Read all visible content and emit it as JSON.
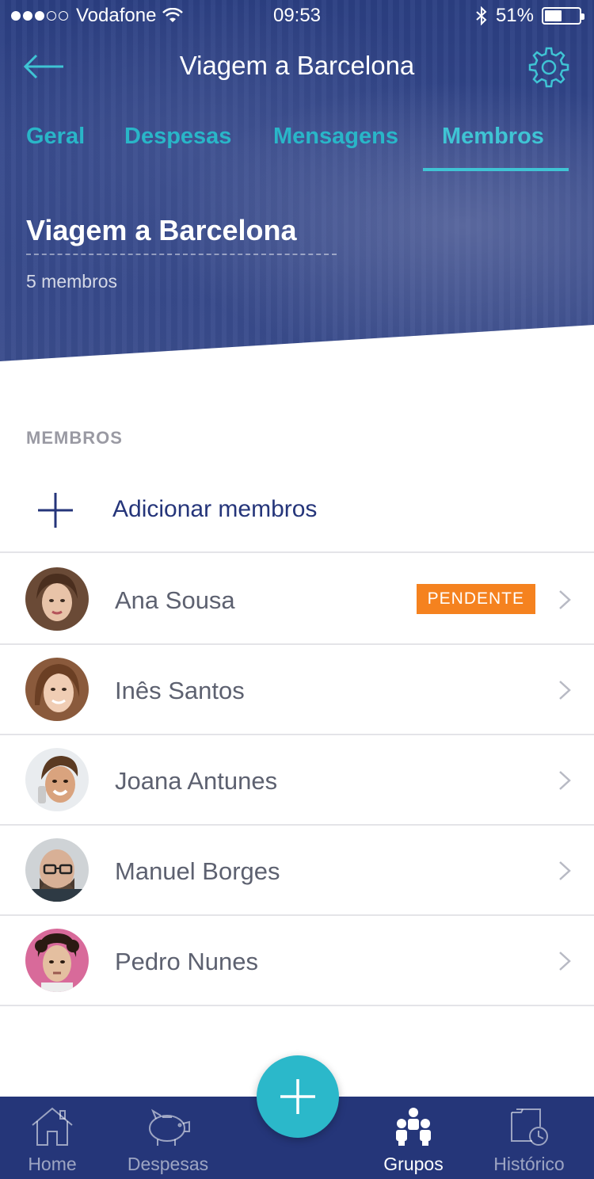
{
  "status_bar": {
    "carrier": "Vodafone",
    "time": "09:53",
    "battery": "51%",
    "battery_level": 0.51
  },
  "nav": {
    "title": "Viagem a Barcelona",
    "back_icon": "arrow-left-icon",
    "settings_icon": "gear-icon"
  },
  "tabs": [
    {
      "label": "Geral",
      "active": false
    },
    {
      "label": "Despesas",
      "active": false
    },
    {
      "label": "Mensagens",
      "active": false
    },
    {
      "label": "Membros",
      "active": true
    }
  ],
  "group": {
    "name": "Viagem a Barcelona",
    "members_count": "5 membros"
  },
  "members_section": {
    "label": "MEMBROS",
    "add_label": "Adicionar membros"
  },
  "members": [
    {
      "name": "Ana Sousa",
      "badge": "PENDENTE"
    },
    {
      "name": "Inês Santos",
      "badge": ""
    },
    {
      "name": "Joana Antunes",
      "badge": ""
    },
    {
      "name": "Manuel Borges",
      "badge": ""
    },
    {
      "name": "Pedro Nunes",
      "badge": ""
    }
  ],
  "tabbar": [
    {
      "label": "Home",
      "icon": "home-icon",
      "active": false
    },
    {
      "label": "Despesas",
      "icon": "piggy-bank-icon",
      "active": false
    },
    {
      "label": "Grupos",
      "icon": "group-icon",
      "active": true
    },
    {
      "label": "Histórico",
      "icon": "history-icon",
      "active": false
    }
  ],
  "colors": {
    "header_bg": "#2f4285",
    "accent": "#2bb8ca",
    "tab_active": "#3fc4d4",
    "badge": "#f5821f",
    "tabbar_bg": "#253679",
    "add_text": "#25357a"
  }
}
